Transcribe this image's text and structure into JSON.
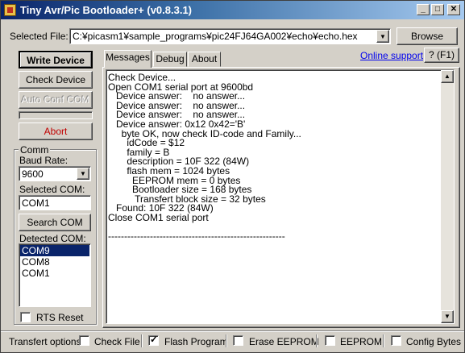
{
  "window": {
    "title": "Tiny Avr/Pic Bootloader+ (v0.8.3.1)",
    "min_glyph": "_",
    "max_glyph": "□",
    "close_glyph": "✕"
  },
  "file": {
    "label": "Selected File:",
    "path": "C:¥picasm1¥sample_programs¥pic24FJ64GA002¥echo¥echo.hex",
    "browse_label": "Browse"
  },
  "actions": {
    "write_label": "Write Device",
    "check_label": "Check Device",
    "autoconf_label": "Auto Conf COM",
    "abort_label": "Abort"
  },
  "comm": {
    "group_label": "Comm",
    "baud_label": "Baud Rate:",
    "baud_value": "9600",
    "selected_com_label": "Selected COM:",
    "selected_com_value": "COM1",
    "search_label": "Search COM",
    "detected_label": "Detected COM:",
    "detected": [
      "COM9",
      "COM8",
      "COM1"
    ],
    "rts_label": "RTS Reset"
  },
  "tabs": [
    "Messages",
    "Debug",
    "About"
  ],
  "links": {
    "online_support": "Online support",
    "help": "? (F1)"
  },
  "log": [
    "Check Device...",
    "Open COM1 serial port at 9600bd",
    "   Device answer:    no answer...",
    "   Device answer:    no answer...",
    "   Device answer:    no answer...",
    "   Device answer: 0x12 0x42='B'",
    "     byte OK, now check ID-code and Family...",
    "       idCode = $12",
    "       family = B",
    "       description = 10F 322 (84W)",
    "       flash mem = 1024 bytes",
    "         EEPROM mem = 0 bytes",
    "         Bootloader size = 168 bytes",
    "          Transfert block size = 32 bytes",
    "   Found: 10F 322 (84W)",
    "Close COM1 serial port",
    "",
    "-------------------------------------------------------"
  ],
  "options": {
    "label": "Transfert options:",
    "items": [
      {
        "label": "Check File",
        "checked": false
      },
      {
        "label": "Flash Program",
        "checked": true
      },
      {
        "label": "Erase EEPROM",
        "checked": false
      },
      {
        "label": "EEPROM",
        "checked": false
      },
      {
        "label": "Config Bytes",
        "checked": false
      }
    ]
  },
  "colors": {
    "abort_text": "#c00000",
    "link": "#0000ee",
    "selection": "#0a246a",
    "title_start": "#0a246a",
    "title_end": "#a6caf0"
  }
}
